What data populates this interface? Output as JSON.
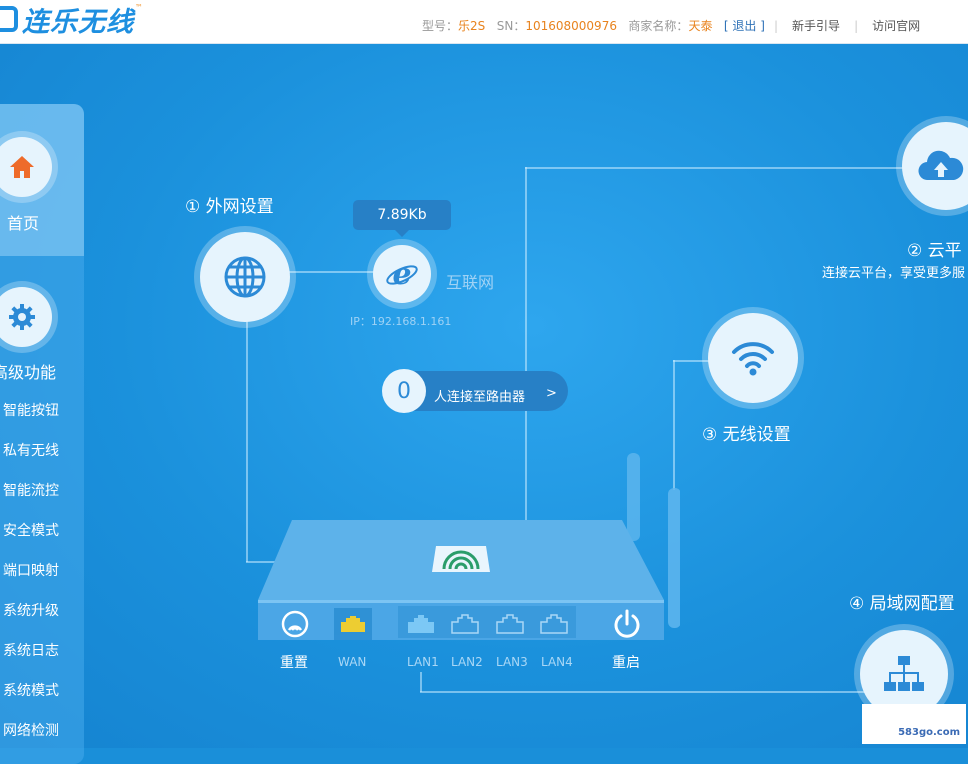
{
  "header": {
    "logo_text": "连乐无线",
    "logo_sup": "™",
    "model_label": "型号：",
    "model_value": "乐2S",
    "sn_label": "SN：",
    "sn_value": "101608000976",
    "merchant_label": "商家名称：",
    "merchant_value": "天泰",
    "logout": "[ 退出 ]",
    "nav_guide": "新手引导",
    "nav_official": "访问官网"
  },
  "sidebar": {
    "home": "首页",
    "advanced": "高级功能",
    "items": [
      "智能按钮",
      "私有无线",
      "智能流控",
      "安全模式",
      "端口映射",
      "系统升级",
      "系统日志",
      "系统模式",
      "网络检测"
    ]
  },
  "diagram": {
    "wan_title": "① 外网设置",
    "speed": "7.89Kb",
    "internet": "互联网",
    "ip": "IP：192.168.1.161",
    "connected_count": "0",
    "connected_text": "人连接至路由器",
    "connected_arrow": ">",
    "cloud_title": "② 云平",
    "cloud_desc": "连接云平台，享受更多服",
    "wireless_title": "③ 无线设置",
    "lan_title": "④ 局域网配置"
  },
  "router": {
    "reset": "重置",
    "wan": "WAN",
    "lan1": "LAN1",
    "lan2": "LAN2",
    "lan3": "LAN3",
    "lan4": "LAN4",
    "reboot": "重启"
  },
  "watermark": "583go.com",
  "colors": {
    "brand": "#1e8fe0",
    "accent": "#e8831e",
    "wan_port": "#ffd21f",
    "lan_port": "#7cc8f5"
  }
}
